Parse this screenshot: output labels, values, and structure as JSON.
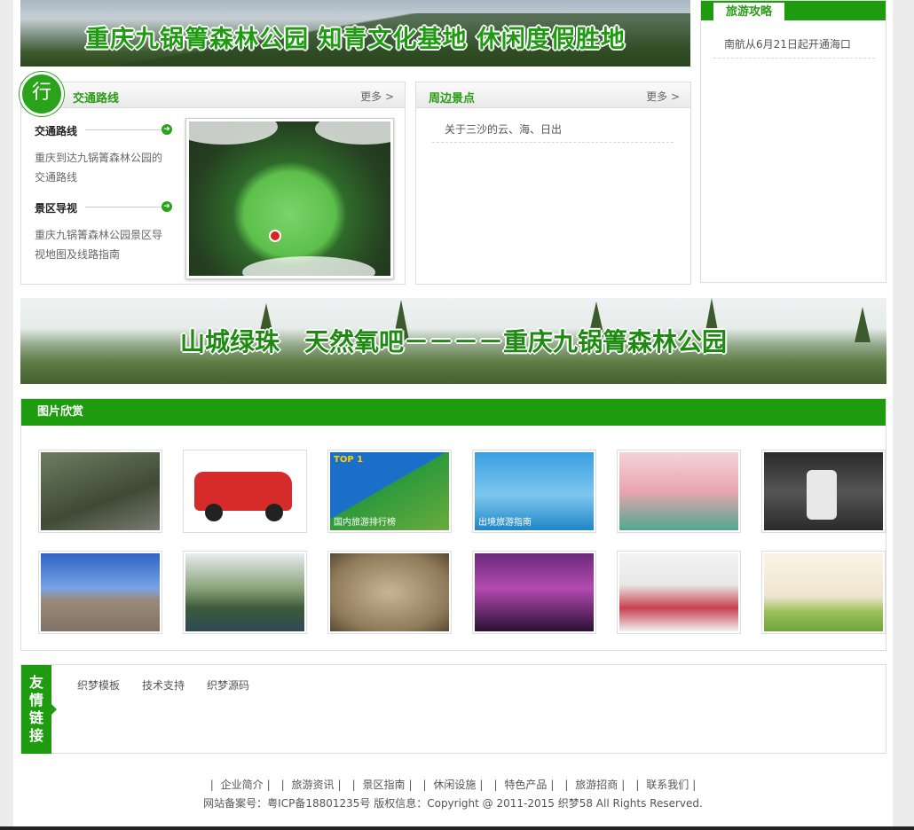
{
  "top_banner": {
    "text": "重庆九锅箐森林公园 知青文化基地 休闲度假胜地"
  },
  "traffic": {
    "badge": "行",
    "title": "交通路线",
    "more": "更多 >",
    "items": [
      {
        "title": "交通路线",
        "desc_line1": "重庆到达九锅箐森林公园的",
        "desc_line2": "交通路线"
      },
      {
        "title": "景区导视",
        "desc_line1": "重庆九锅箐森林公园景区导",
        "desc_line2": "视地图及线路指南"
      }
    ]
  },
  "nearby": {
    "title": "周边景点",
    "more": "更多 >",
    "items": [
      "关于三沙的云、海、日出"
    ]
  },
  "guide": {
    "title": "旅游攻略",
    "items": [
      "南航从6月21日起开通海口"
    ]
  },
  "mid_banner": {
    "text": "山城绿珠　天然氧吧－－－－重庆九锅箐森林公园"
  },
  "gallery": {
    "title": "图片欣赏",
    "captions": {
      "domestic": "国内旅游排行榜",
      "outbound": "出境旅游指南",
      "top": "TOP 1"
    }
  },
  "friend_links": {
    "badge": [
      "友",
      "情",
      "链",
      "接"
    ],
    "links": [
      "织梦模板",
      "技术支持",
      "织梦源码"
    ]
  },
  "footer": {
    "links": [
      "企业简介",
      "旅游资讯",
      "景区指南",
      "休闲设施",
      "特色产品",
      "旅游招商",
      "联系我们"
    ],
    "copyright": "网站备案号：粤ICP备18801235号  版权信息：Copyright @ 2011-2015 织梦58 All Rights Reserved."
  },
  "colors": {
    "brand_green": "#1e9b0e",
    "title_green": "#2b9b15"
  }
}
